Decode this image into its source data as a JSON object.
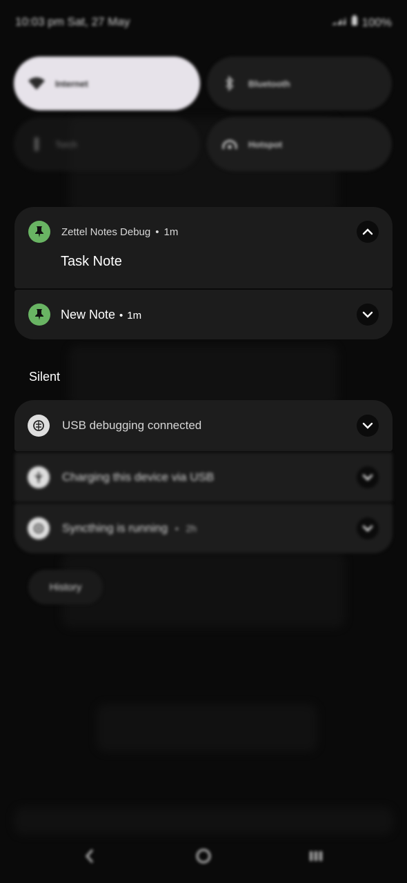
{
  "status_bar": {
    "time_date": "10:03 pm Sat, 27 May",
    "battery": "100%"
  },
  "quick_settings": [
    {
      "label": "Internet",
      "icon": "wifi-icon",
      "active": true
    },
    {
      "label": "Bluetooth",
      "icon": "bluetooth-icon",
      "active": false
    },
    {
      "label": "Torch",
      "icon": "torch-icon",
      "active": false
    },
    {
      "label": "Hotspot",
      "icon": "hotspot-icon",
      "active": false
    }
  ],
  "notifications": {
    "group_header": {
      "app_name": "Zettel Notes Debug",
      "time": "1m",
      "icon": "pin-icon"
    },
    "expanded": {
      "title": "Task Note",
      "chevron_icon": "chevron-up-icon"
    },
    "collapsed": {
      "title": "New Note",
      "time": "1m",
      "icon": "pin-icon",
      "chevron_icon": "chevron-down-icon"
    }
  },
  "silent_section": {
    "label": "Silent",
    "items": [
      {
        "text": "USB debugging connected",
        "icon": "usb-debug-icon"
      },
      {
        "text": "Charging this device via USB",
        "icon": "usb-icon"
      },
      {
        "text": "Syncthing is running",
        "time": "2h",
        "icon": "syncthing-icon"
      }
    ]
  },
  "history_button": {
    "label": "History"
  },
  "nav_bar": {
    "back": "back-icon",
    "home": "home-icon",
    "recents": "recents-icon"
  },
  "colors": {
    "accent_green": "#69b463",
    "card_bg": "#1c1c1c",
    "tile_active": "#e7e3ea"
  }
}
